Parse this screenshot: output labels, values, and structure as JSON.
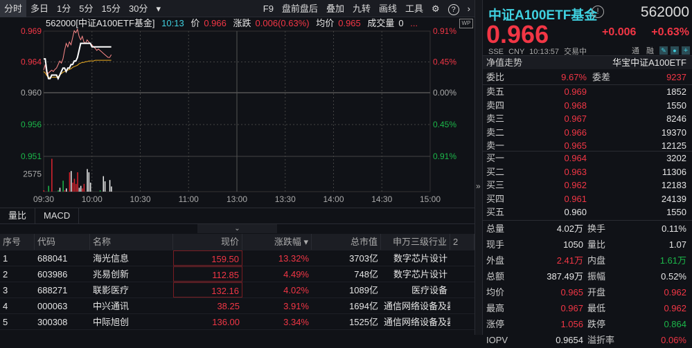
{
  "toolbar": {
    "left": [
      "分时",
      "多日",
      "1分",
      "5分",
      "15分",
      "30分"
    ],
    "more": "▾",
    "right": [
      "F9",
      "盘前盘后",
      "叠加",
      "九转",
      "画线",
      "工具"
    ],
    "settings": "⚙",
    "help": "?",
    "next": "›"
  },
  "info": {
    "code_name": "562000[中证A100ETF基金]",
    "time": "10:13",
    "price_label": "价",
    "price": "0.966",
    "change_label": "涨跌",
    "change": "0.006(0.63%)",
    "avg_label": "均价",
    "avg": "0.965",
    "vol_label": "成交量",
    "vol": "0",
    "ellipsis": "...",
    "badge": "WP"
  },
  "chart_data": {
    "type": "line",
    "prev_close": 0.96,
    "range_pct": 0.91,
    "y_left_ticks": [
      "0.969",
      "0.964",
      "0.960",
      "0.956",
      "0.951"
    ],
    "y_right_ticks": [
      "0.91%",
      "0.45%",
      "0.00%",
      "0.45%",
      "0.91%"
    ],
    "x_ticks": [
      "09:30",
      "10:00",
      "10:30",
      "11:00",
      "13:00",
      "13:30",
      "14:00",
      "14:30",
      "15:00"
    ],
    "volume_tick": "2575",
    "volume_max": 5150,
    "price": [
      0.9648,
      0.9648,
      0.963,
      0.962,
      0.962,
      0.9625,
      0.9625,
      0.9625,
      0.9625,
      0.962,
      0.9625,
      0.963,
      0.9635,
      0.9635,
      0.963,
      0.9635,
      0.9635,
      0.964,
      0.964,
      0.9645,
      0.9645,
      0.965,
      0.966,
      0.967,
      0.967,
      0.967,
      0.967,
      0.967,
      0.967,
      0.967,
      0.9665,
      0.9665,
      0.9665,
      0.9665,
      0.9665,
      0.9665,
      0.9665,
      0.9665,
      0.9665,
      0.9665,
      0.9665,
      0.9665,
      0.9665
    ],
    "avg": [
      0.963,
      0.9628,
      0.9624,
      0.9622,
      0.9622,
      0.9622,
      0.9622,
      0.9622,
      0.9622,
      0.9623,
      0.9625,
      0.9627,
      0.9629,
      0.963,
      0.9631,
      0.9632,
      0.9633,
      0.9634,
      0.9636,
      0.9637,
      0.9638,
      0.9639,
      0.9641,
      0.9642,
      0.9643,
      0.9643,
      0.9644,
      0.9644,
      0.9645,
      0.9645,
      0.9645,
      0.9645,
      0.9646,
      0.9646,
      0.9646,
      0.9646,
      0.9646,
      0.9646,
      0.9646,
      0.9646,
      0.9646,
      0.9646,
      0.9646
    ],
    "iopv": [
      0.9632,
      0.964,
      0.9625,
      0.9628,
      0.963,
      0.9632,
      0.963,
      0.9633,
      0.9635,
      0.964,
      0.9645,
      0.9642,
      0.9648,
      0.966,
      0.967,
      0.9665,
      0.9672,
      0.9668,
      0.9678,
      0.9688,
      0.9685,
      0.969,
      0.968,
      0.9675,
      0.968,
      0.9672,
      0.967,
      0.9675,
      0.9672,
      0.967,
      0.9668,
      0.9665,
      0.9663,
      0.966,
      0.9662,
      0.966,
      0.9658,
      0.9656,
      0.9654,
      0.9652,
      0.965,
      0.965,
      0.9654
    ],
    "volume": [
      200,
      0,
      0,
      900,
      0,
      5100,
      0,
      0,
      0,
      200,
      600,
      0,
      1700,
      200,
      500,
      0,
      3000,
      3200,
      1400,
      2000,
      1200,
      3000,
      600,
      900,
      500,
      1200,
      0,
      3500,
      3000,
      1400,
      0,
      0,
      0,
      0,
      0,
      200,
      0,
      2400,
      1600,
      0,
      0,
      1800,
      800
    ],
    "volume_up": [
      1,
      0,
      0,
      0,
      0,
      1,
      0,
      0,
      0,
      0,
      0,
      0,
      0,
      1,
      0,
      0,
      1,
      0,
      1,
      1,
      1,
      1,
      0,
      0,
      1,
      1,
      0,
      0,
      0,
      0,
      0,
      0,
      0,
      0,
      0,
      0,
      0,
      0,
      0,
      0,
      0,
      0,
      0
    ],
    "volume_down": [
      0,
      0,
      0,
      1,
      0,
      0,
      0,
      0,
      0,
      1,
      0,
      0,
      1,
      0,
      0,
      0,
      0,
      0,
      0,
      0,
      0,
      0,
      0,
      0,
      0,
      0,
      0,
      0,
      0,
      0,
      0,
      0,
      0,
      0,
      0,
      1,
      0,
      0,
      0,
      0,
      0,
      0,
      0
    ]
  },
  "tabs2": [
    "量比",
    "MACD"
  ],
  "table": {
    "headers": [
      "序号",
      "代码",
      "名称",
      "现价",
      "涨跌幅 ▾",
      "总市值",
      "申万三级行业",
      "2"
    ],
    "rows": [
      [
        "1",
        "688041",
        "海光信息",
        "159.50",
        "13.32%",
        "3703亿",
        "数字芯片设计"
      ],
      [
        "2",
        "603986",
        "兆易创新",
        "112.85",
        "4.49%",
        "748亿",
        "数字芯片设计"
      ],
      [
        "3",
        "688271",
        "联影医疗",
        "132.16",
        "4.02%",
        "1089亿",
        "医疗设备"
      ],
      [
        "4",
        "000063",
        "中兴通讯",
        "38.25",
        "3.91%",
        "1694亿",
        "通信网络设备及器"
      ],
      [
        "5",
        "300308",
        "中际旭创",
        "136.00",
        "3.34%",
        "1525亿",
        "通信网络设备及器"
      ]
    ]
  },
  "divider": {
    "expand": "»",
    "collapse": "»"
  },
  "quote": {
    "name": "中证A100ETF基金",
    "info_icon": "!",
    "code": "562000",
    "price": "0.966",
    "change": "+0.006",
    "change_pct": "+0.63%",
    "exchange": "SSE",
    "currency": "CNY",
    "time": "10:13:57",
    "status": "交易中",
    "tong": "通",
    "rong": "融",
    "nav_label": "净值走势",
    "fund_name": "华宝中证A100ETF",
    "weibi_label": "委比",
    "weibi": "9.67%",
    "weicha_label": "委差",
    "weicha": "9237",
    "asks": [
      [
        "卖五",
        "0.969",
        "1852"
      ],
      [
        "卖四",
        "0.968",
        "1550"
      ],
      [
        "卖三",
        "0.967",
        "8246"
      ],
      [
        "卖二",
        "0.966",
        "19370"
      ],
      [
        "卖一",
        "0.965",
        "12125"
      ]
    ],
    "bids": [
      [
        "买一",
        "0.964",
        "3202"
      ],
      [
        "买二",
        "0.963",
        "11306"
      ],
      [
        "买三",
        "0.962",
        "12183"
      ],
      [
        "买四",
        "0.961",
        "24139"
      ],
      [
        "买五",
        "0.960",
        "1550"
      ]
    ],
    "stats": [
      [
        "总量",
        "4.02万",
        "换手",
        "0.11%"
      ],
      [
        "现手",
        "1050",
        "量比",
        "1.07"
      ],
      [
        "外盘",
        "2.41万",
        "内盘",
        "1.61万"
      ],
      [
        "总额",
        "387.49万",
        "振幅",
        "0.52%"
      ],
      [
        "均价",
        "0.965",
        "开盘",
        "0.962"
      ],
      [
        "最高",
        "0.967",
        "最低",
        "0.962"
      ],
      [
        "涨停",
        "1.056",
        "跌停",
        "0.864"
      ],
      [
        "IOPV",
        "0.9654",
        "溢折率",
        "0.06%"
      ]
    ]
  },
  "colors": {
    "up": "#f23645",
    "down": "#1cb84a",
    "accent": "#3fd1e0"
  }
}
